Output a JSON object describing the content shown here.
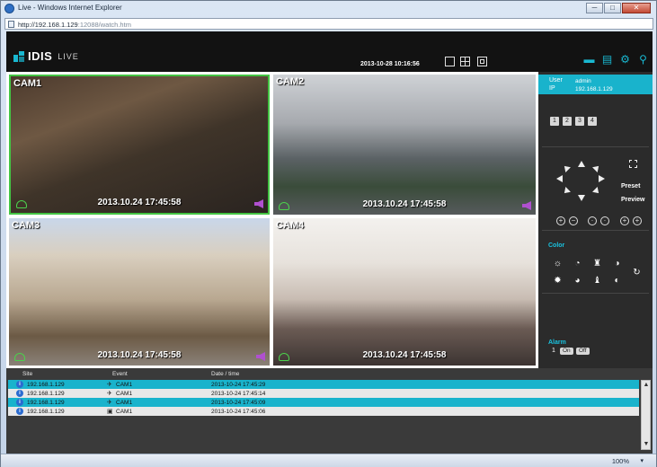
{
  "window": {
    "title": "Live - Windows Internet Explorer",
    "minimize": "─",
    "maximize": "□",
    "close": "✕"
  },
  "address": {
    "host": "http://192.168.1.129",
    "rest": ":12088/watch.htm"
  },
  "app": {
    "brand": "IDIS",
    "mode": "LIVE",
    "datetime": "2013-10-28 10:16:56",
    "layout_icons": [
      "single-layout-icon",
      "quad-layout-icon",
      "fullscreen-icon"
    ],
    "top_icons": [
      "print-icon",
      "save-icon",
      "settings-icon",
      "search-icon"
    ]
  },
  "cameras": [
    {
      "label": "CAM1",
      "timestamp": "2013.10.24 17:45:58",
      "selected": true
    },
    {
      "label": "CAM2",
      "timestamp": "2013.10.24 17:45:58",
      "selected": false
    },
    {
      "label": "CAM3",
      "timestamp": "2013.10.24 17:45:58",
      "selected": false
    },
    {
      "label": "CAM4",
      "timestamp": "2013.10.24 17:45:58",
      "selected": false
    }
  ],
  "user_panel": {
    "user_key": "User",
    "user_value": "admin",
    "ip_key": "IP",
    "ip_value": "192.168.1.129"
  },
  "channels": [
    "1",
    "2",
    "3",
    "4"
  ],
  "ptz": {
    "preset": "Preset",
    "preview": "Preview"
  },
  "color": {
    "title": "Color"
  },
  "alarm": {
    "title": "Alarm",
    "number": "1",
    "on": "On",
    "off": "Off"
  },
  "events": {
    "headers": {
      "site": "Site",
      "event": "Event",
      "datetime": "Date / time"
    },
    "rows": [
      {
        "site": "192.168.1.129",
        "event": "CAM1",
        "time": "2013-10-24 17:45:29",
        "style": "hi"
      },
      {
        "site": "192.168.1.129",
        "event": "CAM1",
        "time": "2013-10-24 17:45:14",
        "style": "lo"
      },
      {
        "site": "192.168.1.129",
        "event": "CAM1",
        "time": "2013-10-24 17:45:09",
        "style": "hi"
      },
      {
        "site": "192.168.1.129",
        "event": "CAM1",
        "time": "2013-10-24 17:45:06",
        "style": "lo"
      }
    ]
  },
  "status": {
    "zoom": "100%"
  },
  "colors": {
    "accent": "#19b3cc",
    "selection": "#43c443",
    "header_bg": "#121212"
  }
}
